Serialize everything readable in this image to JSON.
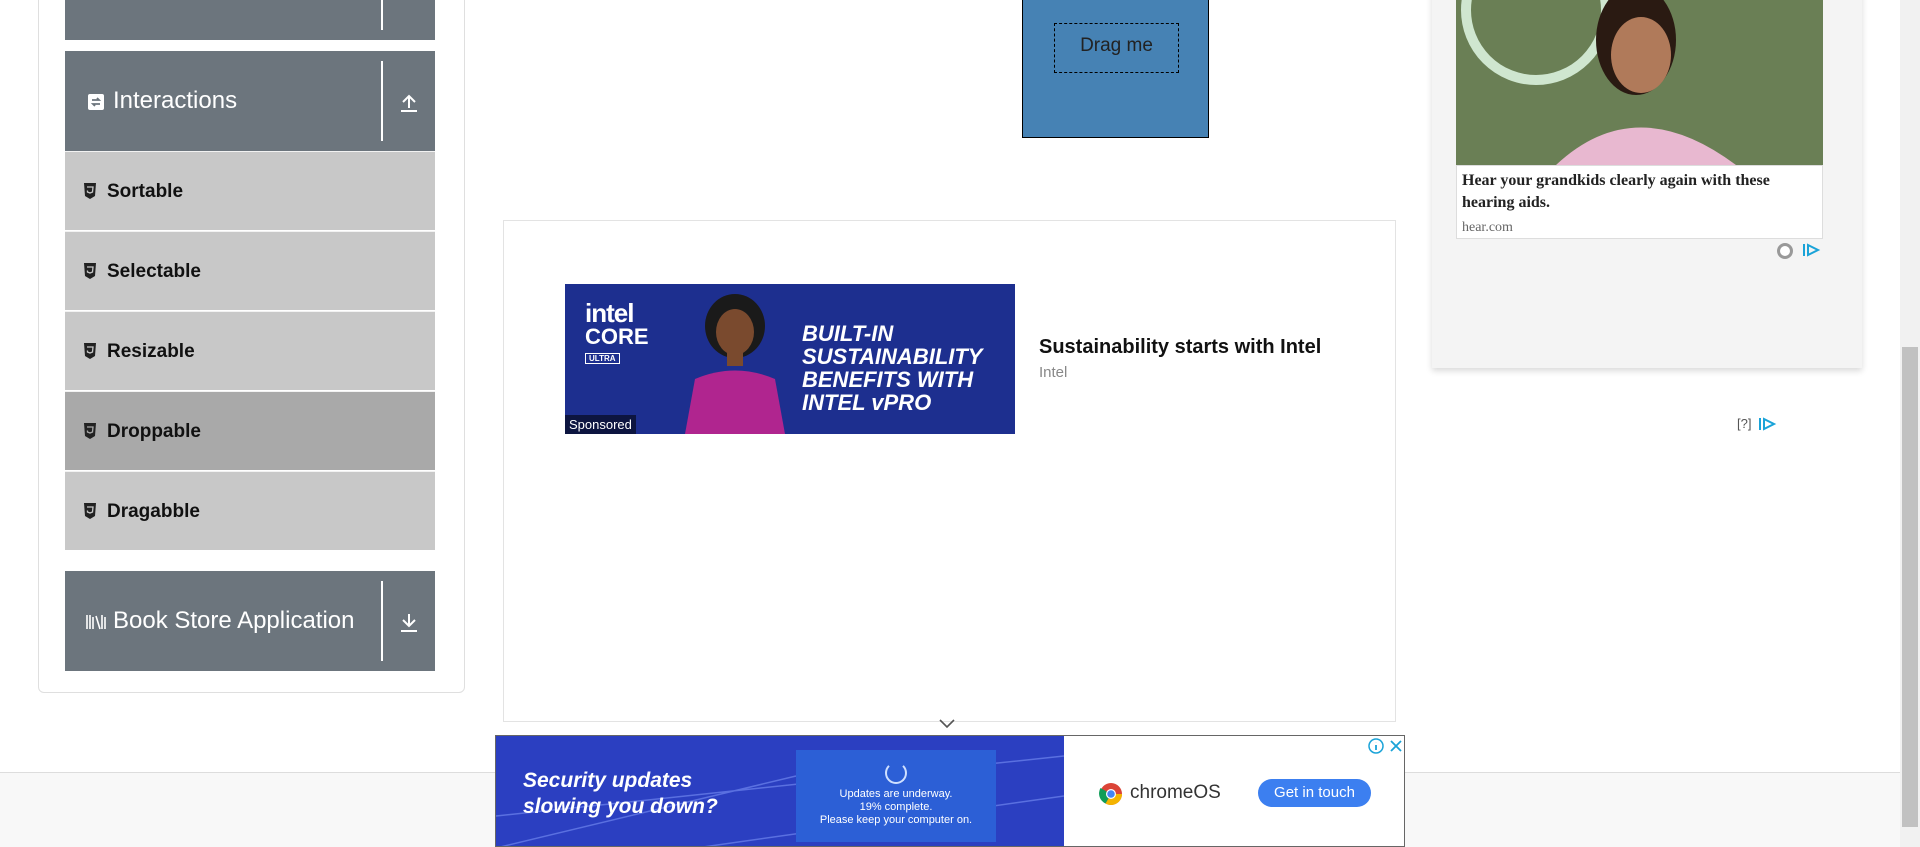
{
  "sidebar": {
    "groups": [
      {
        "title": "Interactions",
        "arrow": "up-arrow-icon",
        "icon": "interactions-icon"
      },
      {
        "title": "Book Store Application",
        "arrow": "down-arrow-icon",
        "icon": "books-icon"
      }
    ],
    "items": [
      {
        "label": "Sortable"
      },
      {
        "label": "Selectable"
      },
      {
        "label": "Resizable"
      },
      {
        "label": "Droppable",
        "active": true
      },
      {
        "label": "Dragabble"
      }
    ]
  },
  "draggable": {
    "label": "Drag me",
    "color": "#4682b4"
  },
  "middle_ad": {
    "banner_logo_top": "intel",
    "banner_logo_mid": "CORE",
    "banner_logo_badge": "ULTRA",
    "banner_headline": [
      "BUILT-IN",
      "SUSTAINABILITY",
      "BENEFITS WITH",
      "INTEL vPRO"
    ],
    "sponsored": "Sponsored",
    "title": "Sustainability starts with Intel",
    "source": "Intel"
  },
  "right_ad": {
    "headline": "Hear your grandkids clearly again with these hearing aids.",
    "domain": "hear.com",
    "help": "[?]"
  },
  "bottom_ad": {
    "headline_1": "Security updates",
    "headline_2": "slowing you down?",
    "screen_line_1": "Updates are underway.",
    "screen_line_2": "19% complete.",
    "screen_line_3": "Please keep your computer on.",
    "brand": "chromeOS",
    "cta": "Get in touch"
  },
  "colors": {
    "group_header": "#6c757d",
    "menu_item": "#c8c8c8",
    "menu_item_active": "#a9a9a9",
    "intel_blue": "#1d2f8f",
    "chrome_cta": "#3c7ff0"
  }
}
